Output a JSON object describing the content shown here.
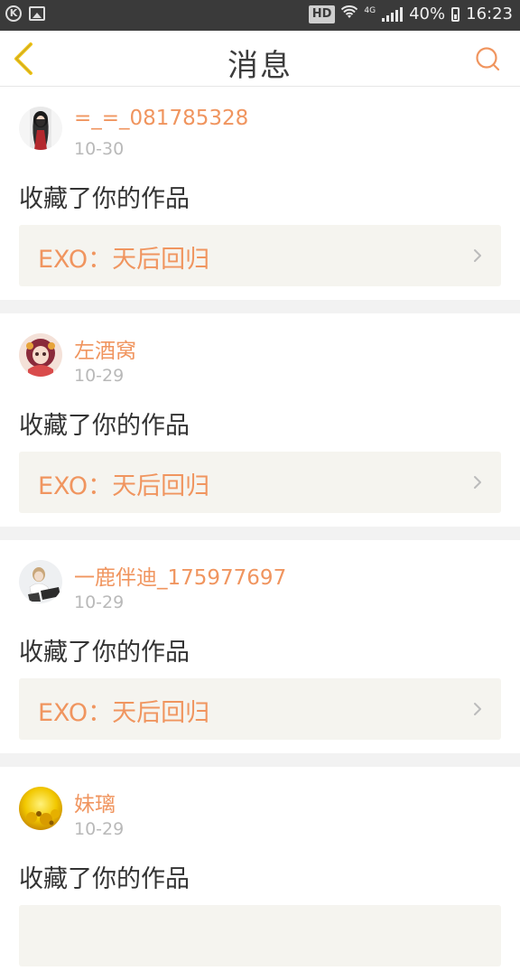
{
  "status_bar": {
    "hd": "HD",
    "network": "4G",
    "battery": "40%",
    "time": "16:23"
  },
  "header": {
    "title": "消息",
    "back_icon": "chevron-left-icon",
    "search_icon": "search-icon"
  },
  "colors": {
    "accent": "#f0955f",
    "back_arrow": "#f0c419",
    "date": "#b9b9b9"
  },
  "messages": [
    {
      "user": "=_=_081785328",
      "date": "10-30",
      "action": "收藏了你的作品",
      "work": "EXO：天后回归"
    },
    {
      "user": "左酒窝",
      "date": "10-29",
      "action": "收藏了你的作品",
      "work": "EXO：天后回归"
    },
    {
      "user": "一鹿伴迪_175977697",
      "date": "10-29",
      "action": "收藏了你的作品",
      "work": "EXO：天后回归"
    },
    {
      "user": "妹璃",
      "date": "10-29",
      "action": "收藏了你的作品"
    }
  ]
}
